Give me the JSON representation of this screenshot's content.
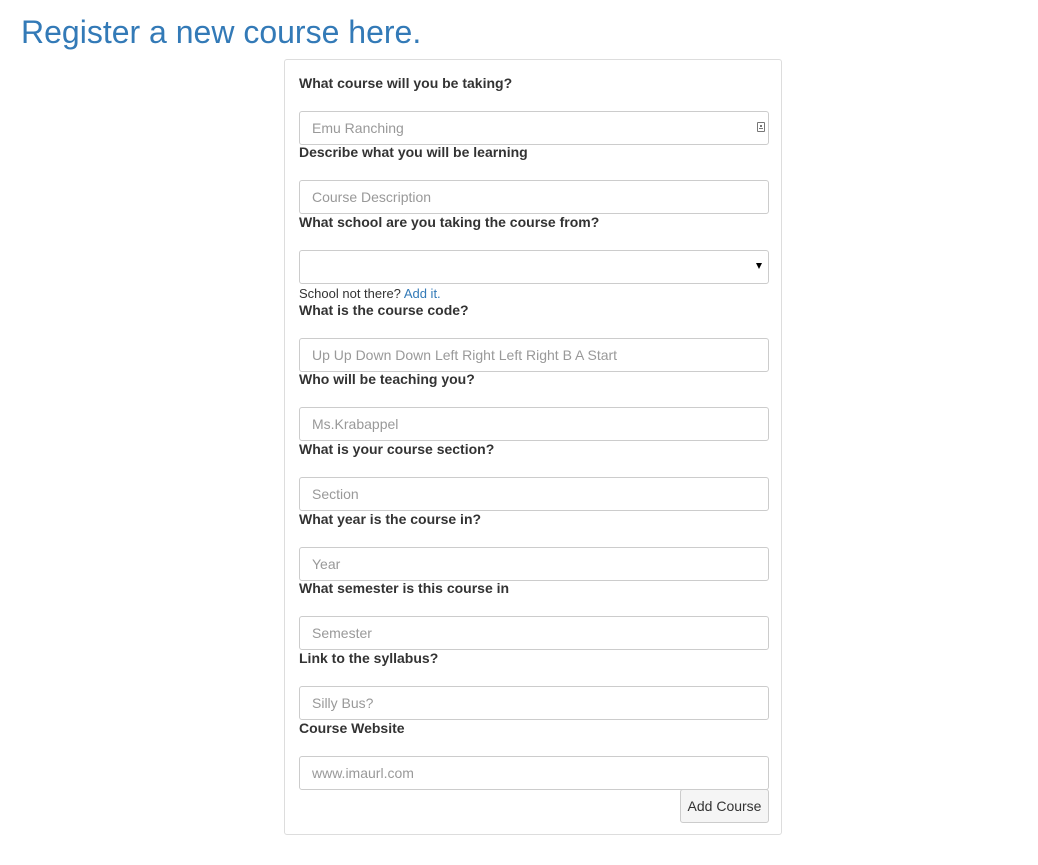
{
  "page": {
    "title": "Register a new course here."
  },
  "form": {
    "fields": [
      {
        "label": "What course will you be taking?",
        "placeholder": "Emu Ranching",
        "icon": "contact-card-icon"
      },
      {
        "label": "Describe what you will be learning",
        "placeholder": "Course Description"
      },
      {
        "label": "What school are you taking the course from?",
        "selected_value": "",
        "help_text": "School not there?",
        "help_link": "Add it."
      },
      {
        "label": "What is the course code?",
        "placeholder": "Up Up Down Down Left Right Left Right B A Start"
      },
      {
        "label": "Who will be teaching you?",
        "placeholder": "Ms.Krabappel"
      },
      {
        "label": "What is your course section?",
        "placeholder": "Section"
      },
      {
        "label": "What year is the course in?",
        "placeholder": "Year"
      },
      {
        "label": "What semester is this course in",
        "placeholder": "Semester"
      },
      {
        "label": "Link to the syllabus?",
        "placeholder": "Silly Bus?"
      },
      {
        "label": "Course Website",
        "placeholder": "www.imaurl.com"
      }
    ],
    "submit_label": "Add Course"
  },
  "colors": {
    "title": "#337ab7",
    "link": "#337ab7",
    "border": "#cccccc",
    "panel_border": "#dddddd"
  }
}
